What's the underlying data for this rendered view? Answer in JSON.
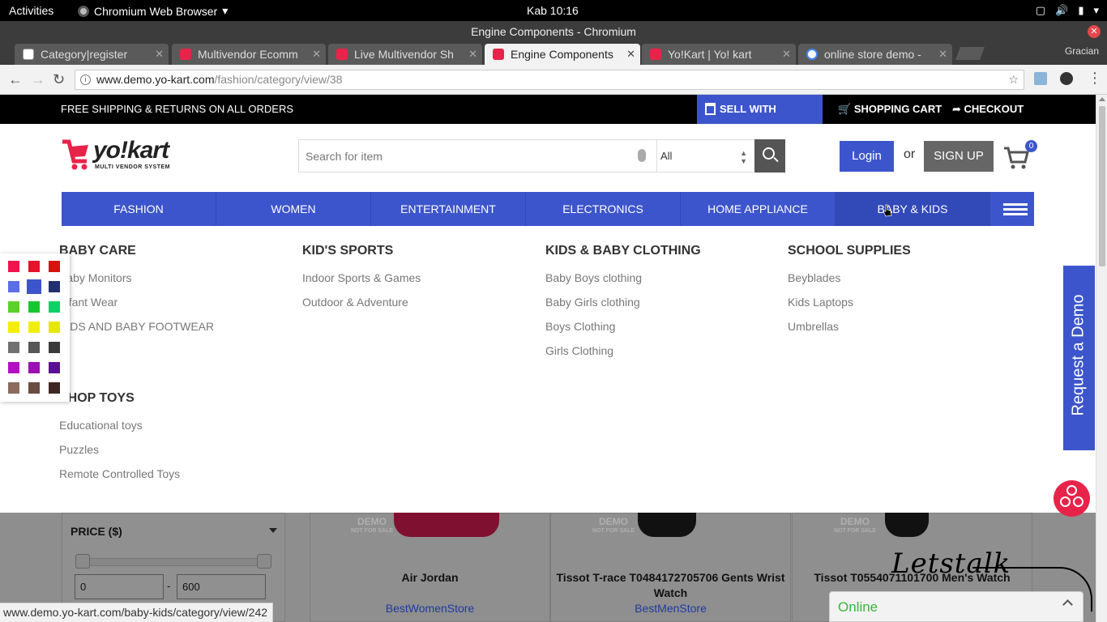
{
  "gnome": {
    "activities": "Activities",
    "app": "Chromium Web Browser",
    "clock": "Kab 10:16"
  },
  "window": {
    "title": "Engine Components - Chromium",
    "profile": "Gracian"
  },
  "tabs": [
    {
      "label": "Category|register",
      "icon": "page-icon"
    },
    {
      "label": "Multivendor Ecomm",
      "icon": "yokart-icon"
    },
    {
      "label": "Live Multivendor Sh",
      "icon": "yokart-icon"
    },
    {
      "label": "Engine Components",
      "icon": "yokart-icon",
      "active": true
    },
    {
      "label": "Yo!Kart | Yo! kart",
      "icon": "yokart-icon"
    },
    {
      "label": "online store demo -",
      "icon": "google-icon"
    }
  ],
  "address": {
    "host": "www.demo.yo-kart.com",
    "path": "/fashion/category/view/38"
  },
  "topbar": {
    "free_shipping": "FREE SHIPPING & RETURNS ON ALL ORDERS",
    "sell": "SELL WITH YOKART",
    "cart": "SHOPPING CART",
    "checkout": "CHECKOUT"
  },
  "logo": {
    "word": "yo!kart",
    "sub": "MULTI VENDOR SYSTEM"
  },
  "search": {
    "placeholder": "Search for item",
    "category": "All"
  },
  "auth": {
    "login": "Login",
    "or": "or",
    "signup": "SIGN UP",
    "cart_count": "0"
  },
  "nav": [
    "FASHION",
    "WOMEN",
    "ENTERTAINMENT",
    "ELECTRONICS",
    "HOME APPLIANCE",
    "BABY & KIDS"
  ],
  "mega_menu": [
    {
      "title": "BABY CARE",
      "items": [
        "Baby Monitors",
        "Infant Wear",
        "KIDS AND BABY FOOTWEAR"
      ]
    },
    {
      "title": "KID'S SPORTS",
      "items": [
        "Indoor Sports & Games",
        "Outdoor & Adventure"
      ]
    },
    {
      "title": "KIDS & BABY CLOTHING",
      "items": [
        "Baby Boys clothing",
        "Baby Girls clothing",
        "Boys Clothing",
        "Girls Clothing"
      ]
    },
    {
      "title": "SCHOOL SUPPLIES",
      "items": [
        "Beyblades",
        "Kids Laptops",
        "Umbrellas"
      ]
    },
    {
      "title": "SHOP TOYS",
      "items": [
        "Educational toys",
        "Puzzles",
        "Remote Controlled Toys"
      ]
    }
  ],
  "swatches": [
    [
      "#f0134d",
      "#e8132a",
      "#d9120d"
    ],
    [
      "#5a6ee6",
      "#3d55cc",
      "#22306e"
    ],
    [
      "#5cd02a",
      "#18c730",
      "#10cf66"
    ],
    [
      "#f5ee0a",
      "#f0ee0a",
      "#e6e60a"
    ],
    [
      "#707070",
      "#575757",
      "#3a3a3a"
    ],
    [
      "#b310c6",
      "#9c0fb4",
      "#5b0e96"
    ],
    [
      "#8a6b5d",
      "#6a4b40",
      "#3e2723"
    ]
  ],
  "filter": {
    "title": "PRICE ($)",
    "min": "0",
    "dash": "-",
    "max": "600"
  },
  "products": [
    {
      "name": "Air Jordan",
      "store": "BestWomenStore"
    },
    {
      "name": "Tissot T-race T0484172705706 Gents Wrist Watch",
      "store": "BestMenStore"
    },
    {
      "name": "Tissot T0554071101700 Men's Watch",
      "store": ""
    }
  ],
  "demo_watermark": {
    "main": "DEMO",
    "sub": "NOT FOR SALE"
  },
  "widgets": {
    "request_demo": "Request a Demo",
    "lets_talk": "Letstalk",
    "online": "Online"
  },
  "status_url": "www.demo.yo-kart.com/baby-kids/category/view/242",
  "colors": {
    "brand_blue": "#3d55cc",
    "brand_red": "#e8234a"
  }
}
